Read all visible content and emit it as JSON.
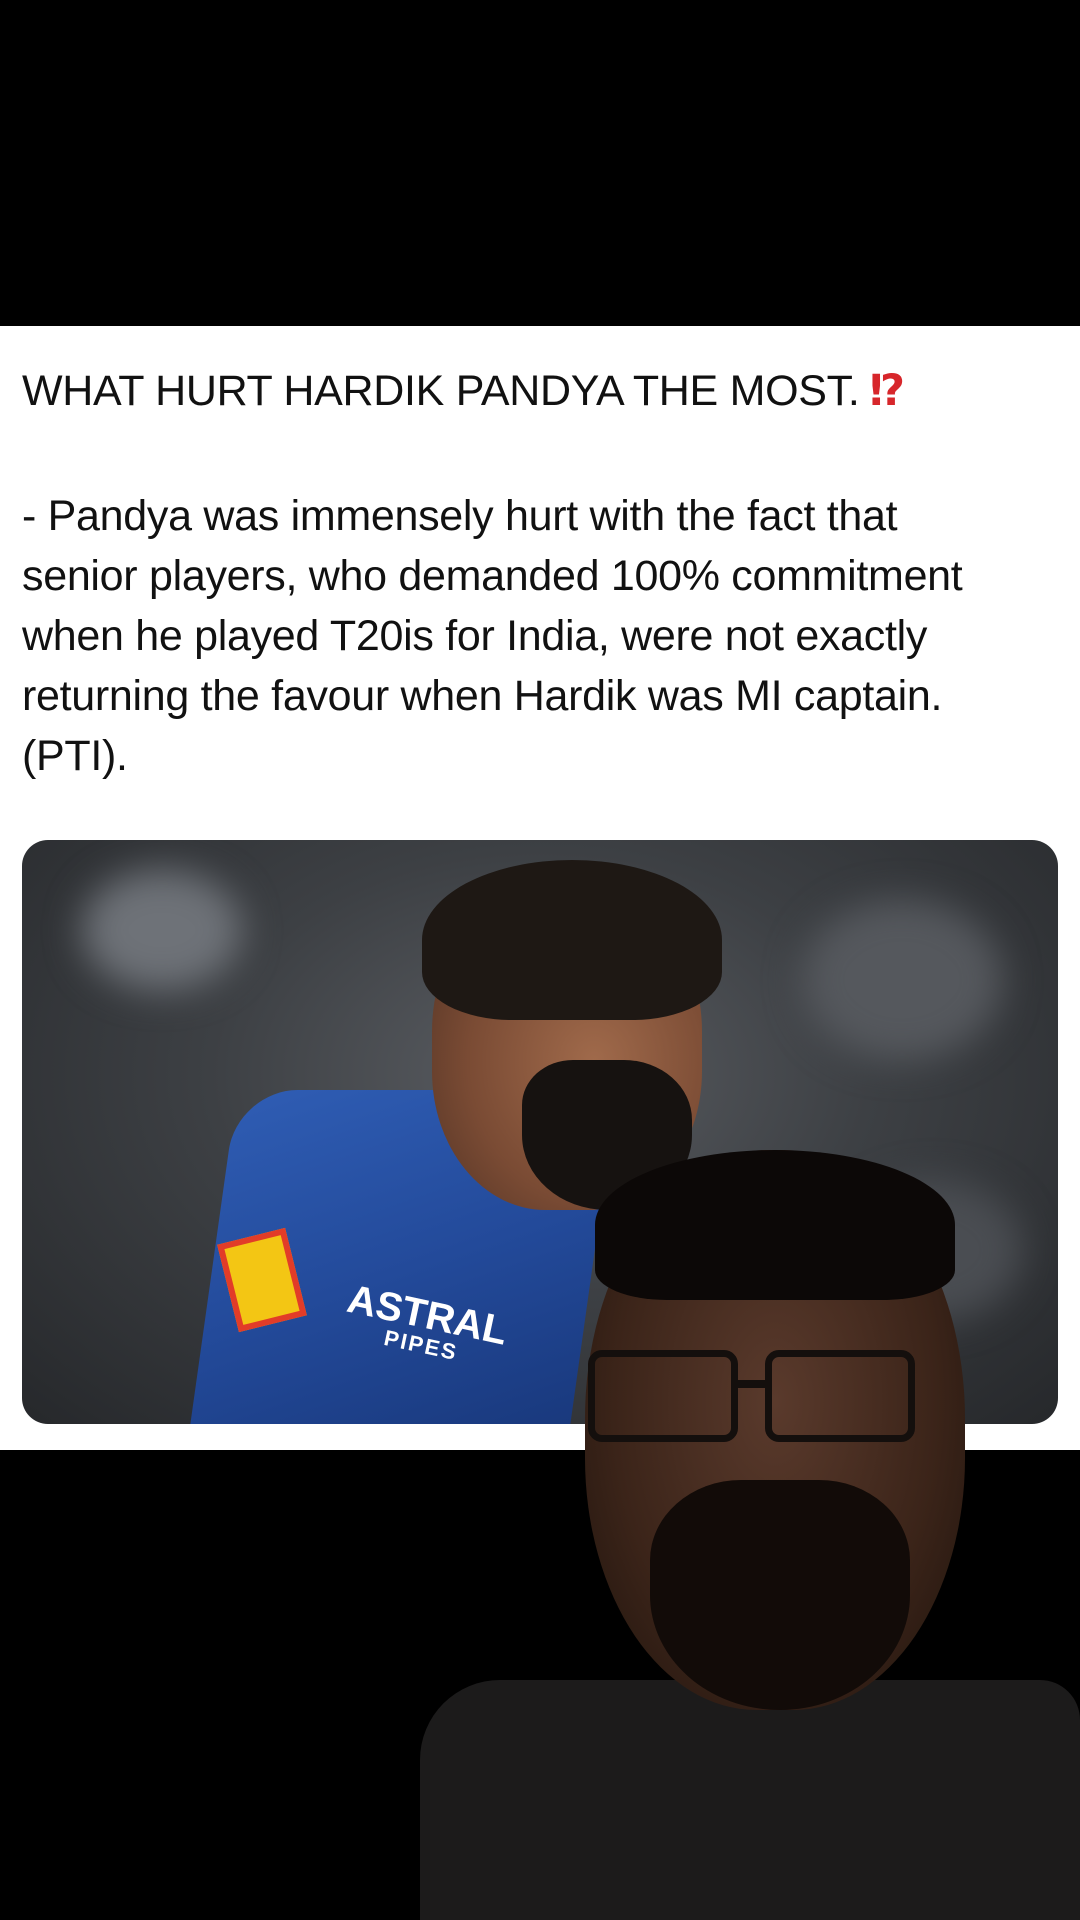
{
  "post": {
    "title": "WHAT HURT HARDIK PANDYA THE MOST.",
    "title_glyph": "⁉",
    "body_lines": [
      "- Pandya was immensely hurt with the fact that",
      "senior players, who demanded 100% commitment",
      "when he played T20is for India, were not exactly",
      "returning the favour when Hardik was MI captain.",
      "(PTI)."
    ]
  },
  "media": {
    "jersey_text": "ASTRAL",
    "jersey_subtext": "PIPES"
  },
  "colors": {
    "background": "#000000",
    "card": "#ffffff",
    "text": "#111111",
    "accent_glyph": "#d7262b",
    "jersey_blue": "#2f5db4"
  }
}
